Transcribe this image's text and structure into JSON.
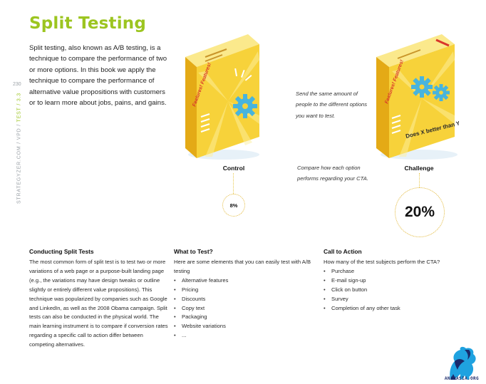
{
  "page": {
    "title": "Split Testing",
    "intro": "Split testing, also known as A/B testing, is a technique to compare the performance of two or more options. In this book we apply the technique to compare the performance of alternative value propositions with customers or to learn more about jobs, pains, and gains.",
    "page_number": "230",
    "side_label": {
      "prefix": "STRATEGYZER.COM / VPD / ",
      "accent": "TEST / 3.3"
    }
  },
  "diagram": {
    "note_top": "Send the same amount of people to the different options you want to test.",
    "note_bottom": "Compare how each option performs regarding your CTA.",
    "control": {
      "label": "Control",
      "result": "8%",
      "box_text": "Features! Features!"
    },
    "challenge": {
      "label": "Challenge",
      "result": "20%",
      "box_text": "Features! Features!",
      "box_message": "Does X better than Y!"
    },
    "colors": {
      "box_face": "#f7d23a",
      "box_side": "#e4aa16",
      "box_top": "#fbe98c",
      "gear": "#48b4dd",
      "accent_red": "#d9362b",
      "title_green": "#9cc520"
    }
  },
  "columns": [
    {
      "title": "Conducting Split Tests",
      "body": "The most common form of split test is to test two or more variations of a web page or a purpose-built landing page (e.g., the variations may have design tweaks or outline slightly or entirely different value propositions). This technique was popularized by companies such as Google and LinkedIn, as well as the 2008 Obama campaign. Split tests can also be conducted in the physical world. The main learning instrument is to compare if conversion rates regarding a specific call to action differ between competing alternatives."
    },
    {
      "title": "What to Test?",
      "body": "Here are some elements that you can easily test with A/B testing",
      "items": [
        "Alternative features",
        "Pricing",
        "Discounts",
        "Copy text",
        "Packaging",
        "Website variations",
        "..."
      ]
    },
    {
      "title": "Call to Action",
      "body": "How many of the test subjects perform the CTA?",
      "items": [
        "Purchase",
        "E-mail sign-up",
        "Click on button",
        "Survey",
        "Completion of any other task"
      ]
    }
  ],
  "watermark": {
    "text": "ANANASIA.ORG",
    "icon": "lion-logo-icon"
  }
}
